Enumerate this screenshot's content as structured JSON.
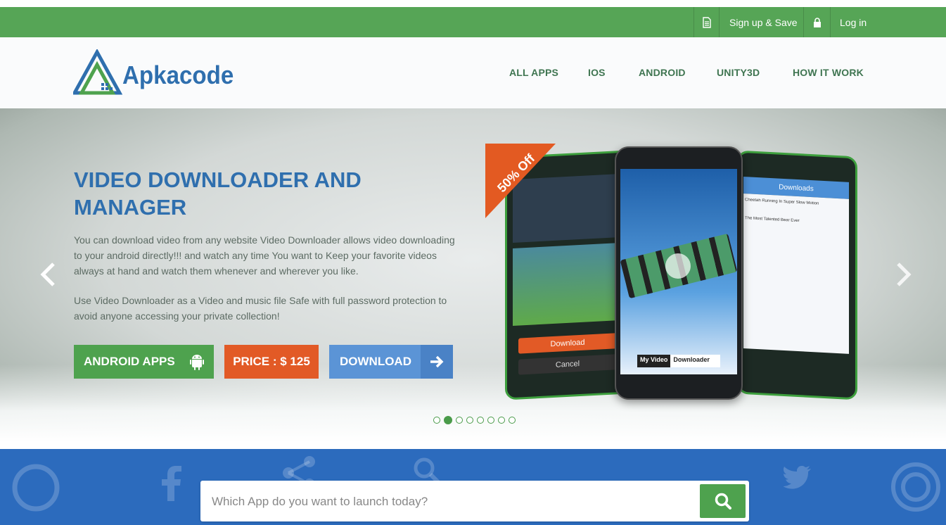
{
  "topbar": {
    "signup_label": "Sign up & Save",
    "login_label": "Log in"
  },
  "brand": {
    "name": "Apkacode"
  },
  "nav": {
    "items": [
      {
        "label": "ALL APPS"
      },
      {
        "label": "IOS"
      },
      {
        "label": "ANDROID"
      },
      {
        "label": "UNITY3D"
      },
      {
        "label": "HOW IT WORK"
      }
    ]
  },
  "hero": {
    "title": "VIDEO DOWNLOADER AND MANAGER",
    "paragraph1": "You can download video from any website Video Downloader allows video downloading to your android directly!!! and watch any time You want to Keep your favorite videos always at hand and watch them whenever and wherever you like.",
    "paragraph2": "Use Video Downloader as a Video and music file Safe with full password protection to avoid anyone accessing your private collection!",
    "badge": "50% Off",
    "buttons": {
      "android": "ANDROID APPS",
      "price": "PRICE : $ 125",
      "download": "DOWNLOAD"
    },
    "slides_count": 8,
    "active_slide": 2,
    "phone_screens": {
      "left_download": "Download",
      "left_cancel": "Cancel",
      "center_label_a": "My Video",
      "center_label_b": "Downloader",
      "right_header": "Downloads",
      "right_item1": "Cheetah Running In Super Slow Motion",
      "right_item2": "The Most Talented Bear Ever"
    }
  },
  "search": {
    "placeholder": "Which App do you want to launch today?"
  },
  "colors": {
    "topbar": "#56a556",
    "brand_blue": "#2f6fae",
    "nav_text": "#3f7551",
    "btn_android": "#4ea24e",
    "btn_price": "#e25a26",
    "btn_download": "#5b94d6",
    "badge": "#e35a22",
    "search_band": "#2c6bbd"
  },
  "icons": [
    "document-icon",
    "lock-icon",
    "android-icon",
    "arrow-right-icon",
    "chevron-left-icon",
    "chevron-right-icon",
    "search-icon"
  ]
}
